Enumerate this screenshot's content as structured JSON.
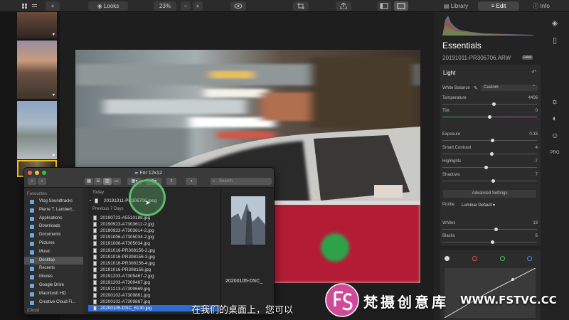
{
  "toolbar": {
    "looks_label": "Looks",
    "zoom_value": "23%",
    "zoom_minus": "−",
    "zoom_plus": "+",
    "add_label": "+"
  },
  "right_tabs": [
    {
      "label": "Library"
    },
    {
      "label": "Edit"
    },
    {
      "label": "Info"
    }
  ],
  "panel": {
    "title": "Essentials",
    "filename": "20191011-PR306706.ARW",
    "raw_badge": "RAW",
    "section": "Light",
    "white_balance_label": "White Balance",
    "white_balance_value": "Custom",
    "sliders": [
      {
        "label": "Temperature",
        "value": "4406",
        "level": 0.55
      },
      {
        "label": "Tint",
        "value": "0",
        "level": 0.5
      },
      {
        "label": "Exposure",
        "value": "0.33",
        "level": 0.53
      },
      {
        "label": "Smart Contrast",
        "value": "4",
        "level": 0.52
      },
      {
        "label": "Highlights",
        "value": "-7",
        "level": 0.46
      },
      {
        "label": "Shadows",
        "value": "7",
        "level": 0.54
      }
    ],
    "advanced_label": "Advanced Settings",
    "profile_label": "Profile",
    "profile_value": "Luminar Default",
    "sliders2": [
      {
        "label": "Whites",
        "value": "13",
        "level": 0.57
      },
      {
        "label": "Blacks",
        "value": "6",
        "level": 0.53
      }
    ]
  },
  "finder": {
    "title": "For 12x12",
    "search_placeholder": "Search",
    "sidebar_heading": "Favourites",
    "sidebar_items": [
      "Vlog Soundtracks",
      "Pierre T. Lambert...",
      "Applications",
      "Downloads",
      "Documents",
      "Pictures",
      "Music",
      "Desktop",
      "Recents",
      "Movies",
      "Google Drive",
      "Macintosh HD",
      "Creative Cloud Fi..."
    ],
    "icloud_label": "iCloud",
    "group_today": "Today",
    "today_files": [
      "20191011-PR306706.jpeg"
    ],
    "group_prev": "Previous 7 Days",
    "prev_files": [
      "20190723-A5510188.jpg",
      "20190923-A7303612-2.jpg",
      "20190923-A7303614-2.jpg",
      "20191006-A7305034-2.jpg",
      "20191006-A7305034.jpg",
      "20191016-PR308156-2.jpg",
      "20191016-PR308156-3.jpg",
      "20191016-PR308156-4.jpg",
      "20191016-PR308156.jpg",
      "20191203-A7309467-2.jpg",
      "20191203-A7309467.jpg",
      "20191213-A7309669.jpg",
      "20200102-A7309861.jpg",
      "20200102-A7309867.jpg",
      "20200105-DSC_6130.jpg"
    ],
    "preview_name": "20200105-DSC_"
  },
  "subtitle": "在我们的桌面上，您可以",
  "watermark": {
    "cn": "梵摄创意库",
    "url": "WWW.FSTVC.CC"
  }
}
